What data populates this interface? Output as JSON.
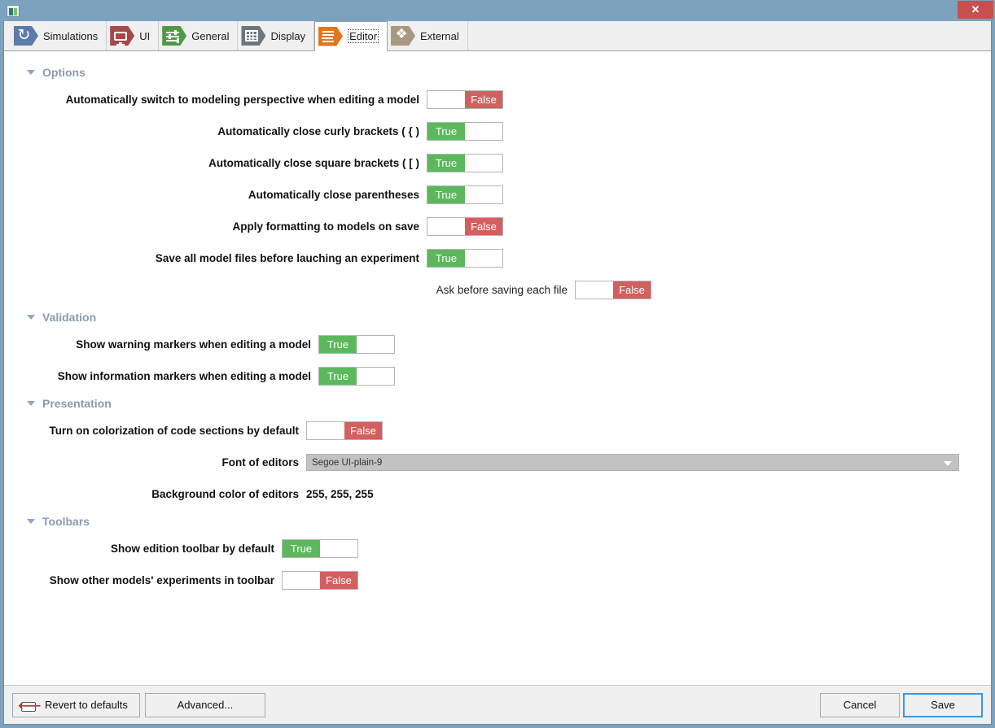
{
  "window": {
    "app_icon": "app-window-icon",
    "close_label": "✕"
  },
  "tabs": [
    {
      "label": "Simulations",
      "icon": "simulations-icon",
      "color": "#5b7ca8",
      "selected": false
    },
    {
      "label": "UI",
      "icon": "monitor-icon",
      "color": "#a8474b",
      "selected": false
    },
    {
      "label": "General",
      "icon": "sliders-icon",
      "color": "#4e9a45",
      "selected": false
    },
    {
      "label": "Display",
      "icon": "grid-icon",
      "color": "#6b7680",
      "selected": false
    },
    {
      "label": "Editor",
      "icon": "editor-lines-icon",
      "color": "#e2761c",
      "selected": true
    },
    {
      "label": "External",
      "icon": "puzzle-icon",
      "color": "#a89880",
      "selected": false
    }
  ],
  "colors": {
    "true_green": "#5cb85c",
    "false_red": "#d2605f",
    "accent_blue": "#3399e6",
    "section_gray": "#8a9bb0",
    "titlebar_blue": "#7da2bd",
    "close_red": "#c7504e"
  },
  "sections": [
    {
      "title": "Options",
      "rows": [
        {
          "label": "Automatically switch to modeling perspective when editing a model",
          "type": "toggle",
          "value": "False",
          "bold": true,
          "label_width": 478,
          "indent": 32
        },
        {
          "label": "Automatically close curly brackets ( { )",
          "type": "toggle",
          "value": "True",
          "bold": true,
          "label_width": 478,
          "indent": 32
        },
        {
          "label": "Automatically close square brackets ( [ )",
          "type": "toggle",
          "value": "True",
          "bold": true,
          "label_width": 478,
          "indent": 32
        },
        {
          "label": "Automatically close parentheses",
          "type": "toggle",
          "value": "True",
          "bold": true,
          "label_width": 478,
          "indent": 32
        },
        {
          "label": "Apply formatting to models on save",
          "type": "toggle",
          "value": "False",
          "bold": true,
          "label_width": 478,
          "indent": 32
        },
        {
          "label": "Save all model files before lauching an experiment",
          "type": "toggle",
          "value": "True",
          "bold": true,
          "label_width": 478,
          "indent": 32
        },
        {
          "label": "Ask before saving each file",
          "type": "toggle",
          "value": "False",
          "bold": false,
          "label_width": 178,
          "indent": 514
        }
      ]
    },
    {
      "title": "Validation",
      "rows": [
        {
          "label": "Show warning markers when editing a model",
          "type": "toggle",
          "value": "True",
          "bold": true,
          "label_width": 345,
          "indent": 32
        },
        {
          "label": "Show information markers when editing a model",
          "type": "toggle",
          "value": "True",
          "bold": true,
          "label_width": 345,
          "indent": 32
        }
      ]
    },
    {
      "title": "Presentation",
      "rows": [
        {
          "label": "Turn on colorization of code sections by default",
          "type": "toggle",
          "value": "False",
          "bold": true,
          "label_width": 330,
          "indent": 32
        },
        {
          "label": "Font of editors",
          "type": "combo",
          "value": "Segoe UI-plain-9",
          "bold": true,
          "label_width": 330,
          "indent": 32
        },
        {
          "label": "Background color of editors",
          "type": "text",
          "value": "255, 255, 255",
          "bold": true,
          "label_width": 330,
          "indent": 32
        }
      ]
    },
    {
      "title": "Toolbars",
      "rows": [
        {
          "label": "Show edition toolbar by default",
          "type": "toggle",
          "value": "True",
          "bold": true,
          "label_width": 300,
          "indent": 32
        },
        {
          "label": "Show other models' experiments in toolbar",
          "type": "toggle",
          "value": "False",
          "bold": true,
          "label_width": 300,
          "indent": 32
        }
      ]
    }
  ],
  "footer": {
    "revert_label": "Revert to defaults",
    "revert_icon": "undo-arrow-icon",
    "advanced_label": "Advanced...",
    "cancel_label": "Cancel",
    "save_label": "Save"
  }
}
